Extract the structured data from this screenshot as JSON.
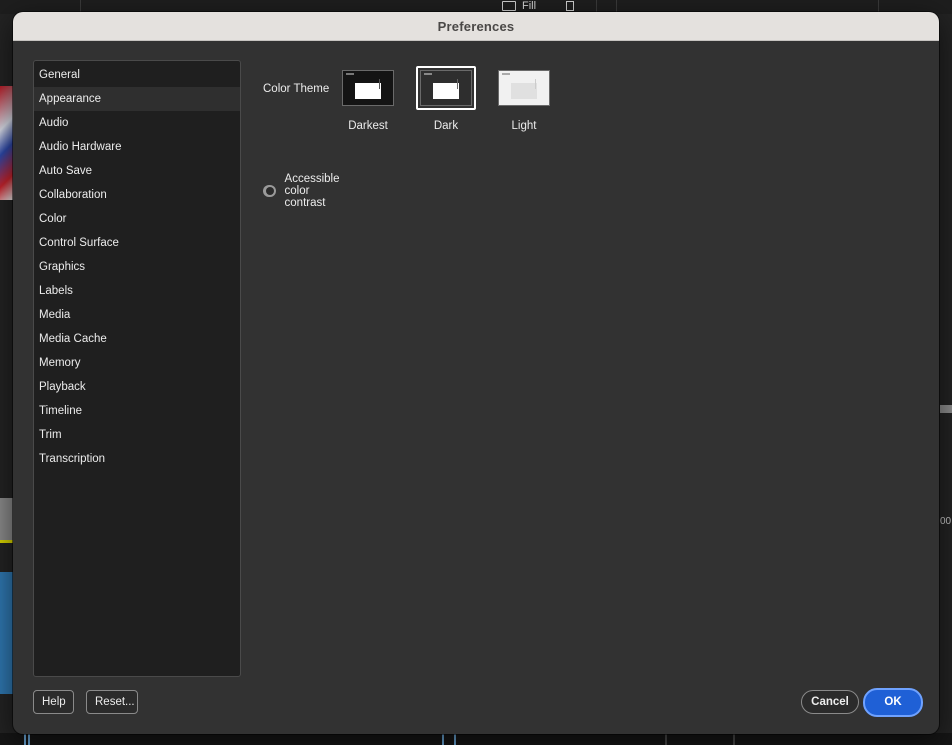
{
  "background_app": {
    "fill_label": "Fill",
    "right_edge_text": "00"
  },
  "dialog": {
    "title": "Preferences"
  },
  "sidebar": {
    "items": [
      {
        "label": "General",
        "active": false
      },
      {
        "label": "Appearance",
        "active": true
      },
      {
        "label": "Audio",
        "active": false
      },
      {
        "label": "Audio Hardware",
        "active": false
      },
      {
        "label": "Auto Save",
        "active": false
      },
      {
        "label": "Collaboration",
        "active": false
      },
      {
        "label": "Color",
        "active": false
      },
      {
        "label": "Control Surface",
        "active": false
      },
      {
        "label": "Graphics",
        "active": false
      },
      {
        "label": "Labels",
        "active": false
      },
      {
        "label": "Media",
        "active": false
      },
      {
        "label": "Media Cache",
        "active": false
      },
      {
        "label": "Memory",
        "active": false
      },
      {
        "label": "Playback",
        "active": false
      },
      {
        "label": "Timeline",
        "active": false
      },
      {
        "label": "Trim",
        "active": false
      },
      {
        "label": "Transcription",
        "active": false
      }
    ]
  },
  "appearance": {
    "color_theme_label": "Color Theme",
    "themes": [
      {
        "name": "Darkest",
        "selected": false,
        "bg": "#141414",
        "inner": "#ffffff"
      },
      {
        "name": "Dark",
        "selected": true,
        "bg": "#2e2e2e",
        "inner": "#ffffff"
      },
      {
        "name": "Light",
        "selected": false,
        "bg": "#f1f1f1",
        "inner": "#e0e0e0"
      }
    ],
    "accessible_contrast": {
      "label": "Accessible color contrast",
      "enabled": true
    }
  },
  "footer": {
    "help_label": "Help",
    "reset_label": "Reset...",
    "cancel_label": "Cancel",
    "ok_label": "OK"
  }
}
